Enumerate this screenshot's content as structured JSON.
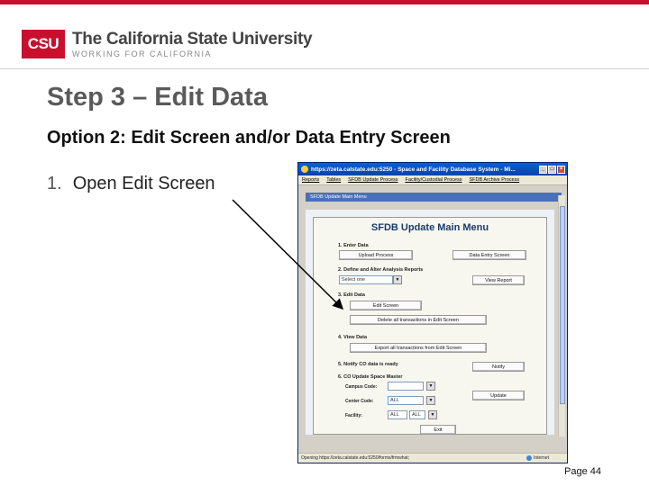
{
  "header": {
    "logo_mark": "CSU",
    "logo_title": "The California State University",
    "logo_subtitle": "WORKING FOR CALIFORNIA"
  },
  "slide": {
    "title": "Step 3 – Edit Data",
    "option": "Option 2:  Edit Screen and/or Data Entry Screen",
    "list_items": [
      {
        "number": "1.",
        "text": "Open Edit Screen"
      }
    ],
    "page_label": "Page 44"
  },
  "colors": {
    "brand_red": "#c8102e",
    "title_gray": "#5a5a5a",
    "window_blue": "#0a5fd8"
  },
  "browser": {
    "title": "https://zeta.calstate.edu:5250 - Space and Facility Database System - Mi...",
    "menu": [
      "Reports",
      "Tables",
      "SFDB Update Process",
      "Facility/Custodial Process",
      "SFDB Archive Process"
    ],
    "tab": "SFDB Update Main Menu",
    "status_left": "Opening https://zeta.calstate.edu:5250/forms/frmwhat;",
    "status_right": "Internet"
  },
  "form": {
    "heading": "SFDB Update Main Menu",
    "sections": {
      "s1": "1. Enter Data",
      "s2": "2. Define and Alter Analysis Reports",
      "s3": "3. Edit Data",
      "s4": "4. View Data",
      "s5": "5. Notify CO data is ready",
      "s6": "6. CO Update Space Master"
    },
    "buttons": {
      "upload_process": "Upload Process",
      "data_entry_screen": "Data Entry Screen",
      "view_report": "View Report",
      "edit_screen": "Edit Screen",
      "delete_all": "Delete all transactions in Edit Screen",
      "export_all": "Export all transactions from Edit Screen",
      "notify": "Notify",
      "update": "Update",
      "exit": "Exit"
    },
    "select_report": "Select one",
    "fields": {
      "campus_code_label": "Campus Code:",
      "campus_code_value": "",
      "center_code_label": "Center Code:",
      "center_code_value": "ALL",
      "facility_label": "Facility:",
      "facility_value_1": "ALL",
      "facility_value_2": "ALL"
    }
  }
}
